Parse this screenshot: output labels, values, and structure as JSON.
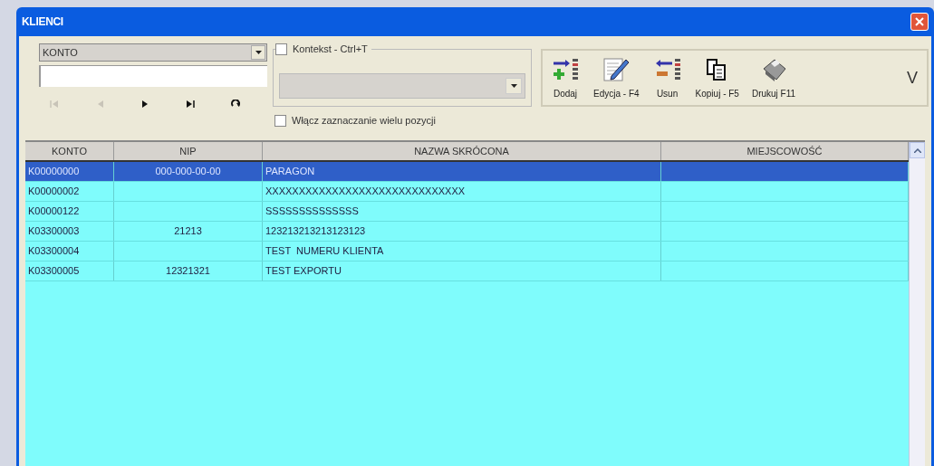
{
  "window": {
    "title": "KLIENCI"
  },
  "filter": {
    "field": "KONTO",
    "nav": [
      {
        "kind": "first",
        "disabled": true
      },
      {
        "kind": "prev",
        "disabled": true
      },
      {
        "kind": "next",
        "disabled": false
      },
      {
        "kind": "last",
        "disabled": false
      },
      {
        "kind": "refresh",
        "disabled": false
      }
    ]
  },
  "context": {
    "label": "Kontekst - Ctrl+T",
    "checked": false
  },
  "multi_select": {
    "label": "Włącz zaznaczanie wielu pozycji",
    "checked": false
  },
  "toolbar": {
    "buttons": [
      {
        "kind": "add",
        "label": "Dodaj"
      },
      {
        "kind": "edit",
        "label": "Edycja - F4"
      },
      {
        "kind": "remove",
        "label": "Usun"
      },
      {
        "kind": "copy",
        "label": "Kopiuj - F5"
      },
      {
        "kind": "print",
        "label": "Drukuj F11"
      }
    ],
    "more": "V"
  },
  "table": {
    "columns": [
      "KONTO",
      "NIP",
      "NAZWA SKRÓCONA",
      "MIEJSCOWOŚĆ"
    ],
    "rows": [
      {
        "cells": [
          "K00000000",
          "000-000-00-00",
          "PARAGON",
          ""
        ],
        "selected": true
      },
      {
        "cells": [
          "K00000002",
          "",
          "XXXXXXXXXXXXXXXXXXXXXXXXXXXXXX",
          ""
        ],
        "selected": false
      },
      {
        "cells": [
          "K00000122",
          "",
          "SSSSSSSSSSSSSS",
          ""
        ],
        "selected": false
      },
      {
        "cells": [
          "K03300003",
          "21213",
          "123213213213123123",
          ""
        ],
        "selected": false
      },
      {
        "cells": [
          "K03300004",
          "",
          "TEST  NUMERU KLIENTA",
          ""
        ],
        "selected": false
      },
      {
        "cells": [
          "K03300005",
          "12321321",
          "TEST EXPORTU",
          ""
        ],
        "selected": false
      }
    ]
  }
}
